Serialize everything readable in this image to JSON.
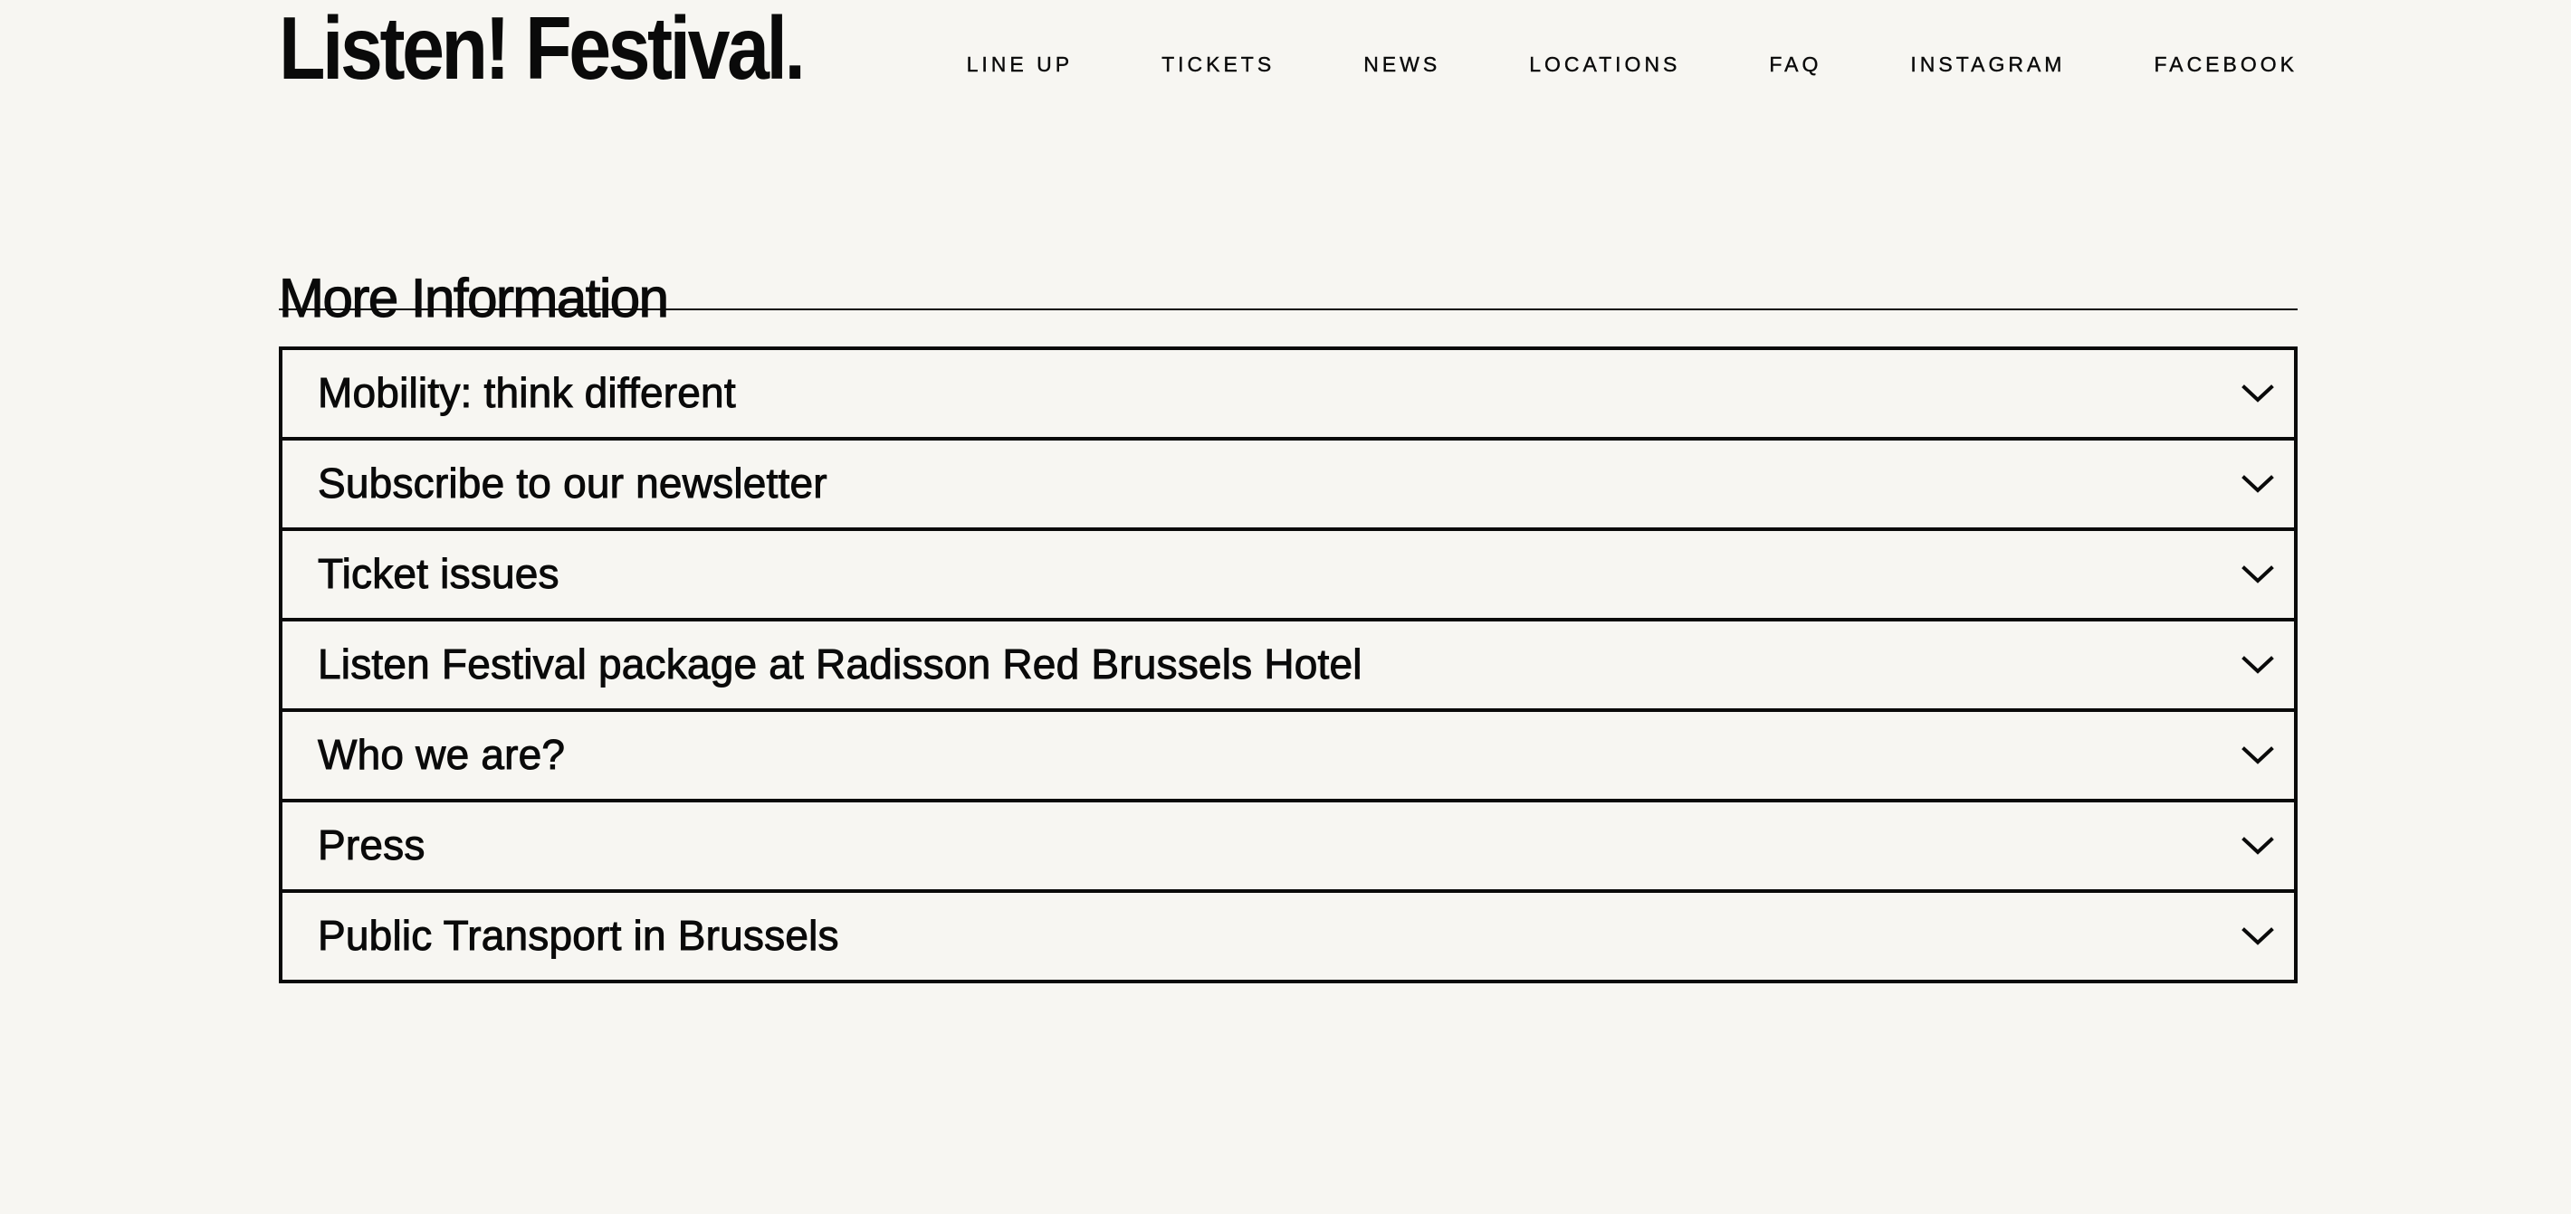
{
  "header": {
    "logo_text": "Listen! Festival.",
    "nav": [
      {
        "label": "LINE UP"
      },
      {
        "label": "TICKETS"
      },
      {
        "label": "NEWS"
      },
      {
        "label": "LOCATIONS"
      },
      {
        "label": "FAQ"
      },
      {
        "label": "INSTAGRAM"
      },
      {
        "label": "FACEBOOK"
      }
    ]
  },
  "main": {
    "section_title": "More Information",
    "accordion": [
      {
        "label": "Mobility: think different",
        "icon": "chevron-down-icon"
      },
      {
        "label": "Subscribe to our newsletter",
        "icon": "chevron-down-icon"
      },
      {
        "label": "Ticket issues",
        "icon": "chevron-down-icon"
      },
      {
        "label": "Listen Festival package at Radisson Red Brussels Hotel",
        "icon": "chevron-down-icon"
      },
      {
        "label": "Who we are?",
        "icon": "chevron-down-icon"
      },
      {
        "label": "Press",
        "icon": "chevron-down-icon"
      },
      {
        "label": "Public Transport in Brussels",
        "icon": "chevron-down-icon"
      }
    ]
  },
  "colors": {
    "background": "#f7f6f2",
    "text": "#0a0a0a"
  }
}
